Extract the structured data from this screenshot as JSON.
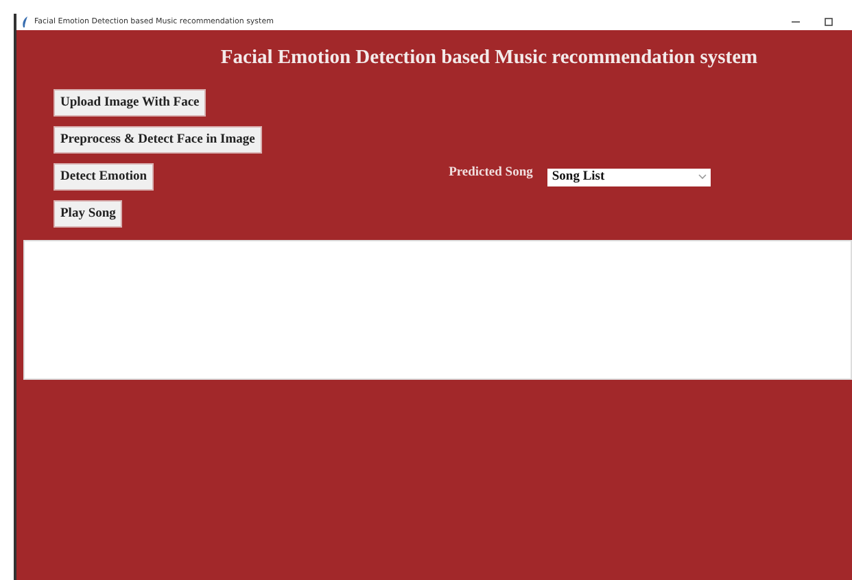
{
  "window": {
    "title": "Facial Emotion Detection based Music recommendation system"
  },
  "heading": "Facial Emotion Detection based Music recommendation system",
  "buttons": [
    {
      "label": "Upload Image With Face"
    },
    {
      "label": "Preprocess & Detect Face in Image"
    },
    {
      "label": "Detect Emotion"
    },
    {
      "label": "Play Song"
    }
  ],
  "predicted_song": {
    "label": "Predicted Song",
    "value": "Song List"
  }
}
